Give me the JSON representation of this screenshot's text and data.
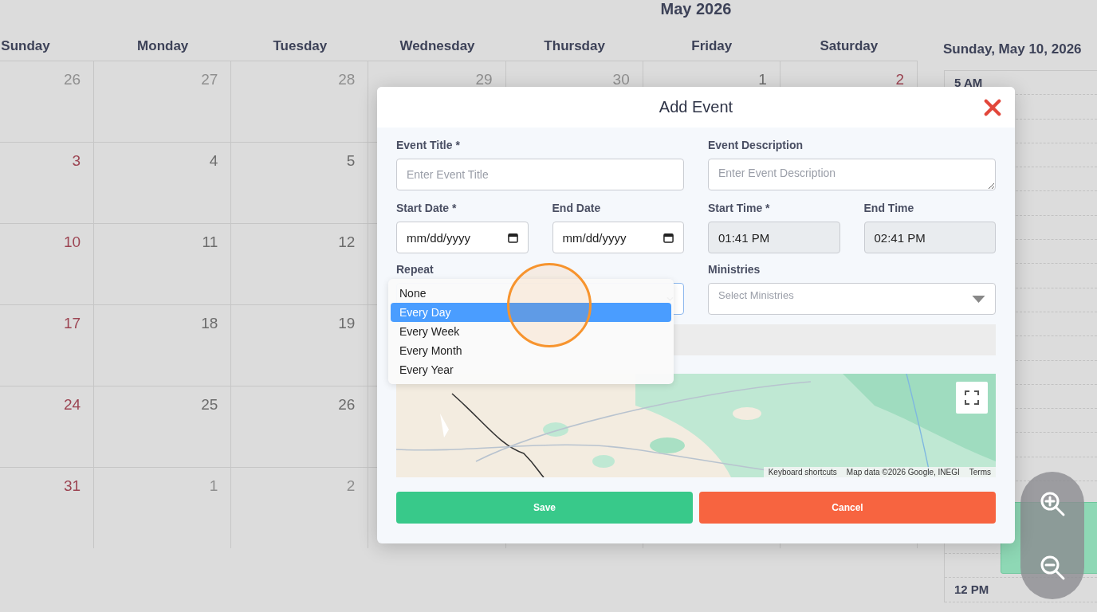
{
  "calendar": {
    "title": "May 2026",
    "weekdays": [
      "Sunday",
      "Monday",
      "Tuesday",
      "Wednesday",
      "Thursday",
      "Friday",
      "Saturday"
    ],
    "weeks": [
      [
        {
          "day": "26",
          "muted": true
        },
        {
          "day": "27",
          "muted": true
        },
        {
          "day": "28",
          "muted": true
        },
        {
          "day": "29",
          "muted": true
        },
        {
          "day": "30",
          "muted": true
        },
        {
          "day": "1",
          "muted": false
        },
        {
          "day": "2",
          "muted": false
        }
      ],
      [
        {
          "day": "3",
          "muted": false
        },
        {
          "day": "4",
          "muted": false
        },
        {
          "day": "5",
          "muted": false
        }
      ],
      [
        {
          "day": "10",
          "muted": false
        },
        {
          "day": "11",
          "muted": false
        },
        {
          "day": "12",
          "muted": false
        }
      ],
      [
        {
          "day": "17",
          "muted": false
        },
        {
          "day": "18",
          "muted": false
        },
        {
          "day": "19",
          "muted": false
        }
      ],
      [
        {
          "day": "24",
          "muted": false
        },
        {
          "day": "25",
          "muted": false
        },
        {
          "day": "26",
          "muted": false
        }
      ],
      [
        {
          "day": "31",
          "muted": false
        },
        {
          "day": "1",
          "muted": true
        },
        {
          "day": "2",
          "muted": true
        }
      ]
    ]
  },
  "day_view": {
    "title": "Sunday, May 10, 2026",
    "time_labels": [
      "5 AM",
      "12 PM"
    ]
  },
  "modal": {
    "title": "Add Event",
    "event_title": {
      "label": "Event Title *",
      "placeholder": "Enter Event Title"
    },
    "event_description": {
      "label": "Event Description",
      "placeholder": "Enter Event Description"
    },
    "start_date": {
      "label": "Start Date *",
      "value": "mm/dd/yyyy"
    },
    "end_date": {
      "label": "End Date",
      "value": "mm/dd/yyyy"
    },
    "start_time": {
      "label": "Start Time *",
      "value": "01:41 PM"
    },
    "end_time": {
      "label": "End Time",
      "value": "02:41 PM"
    },
    "repeat": {
      "label": "Repeat",
      "expanded": true,
      "options": [
        {
          "label": "None",
          "selected": false
        },
        {
          "label": "Every Day",
          "selected": true
        },
        {
          "label": "Every Week",
          "selected": false
        },
        {
          "label": "Every Month",
          "selected": false
        },
        {
          "label": "Every Year",
          "selected": false
        }
      ]
    },
    "ministries": {
      "label": "Ministries",
      "placeholder": "Select Ministries"
    },
    "map": {
      "kind": "picture",
      "attribution": [
        "Keyboard shortcuts",
        "Map data ©2026 Google, INEGI",
        "Terms"
      ]
    },
    "buttons": [
      {
        "label": "Save",
        "kind": "save"
      },
      {
        "label": "Cancel",
        "kind": "cancel"
      }
    ]
  }
}
